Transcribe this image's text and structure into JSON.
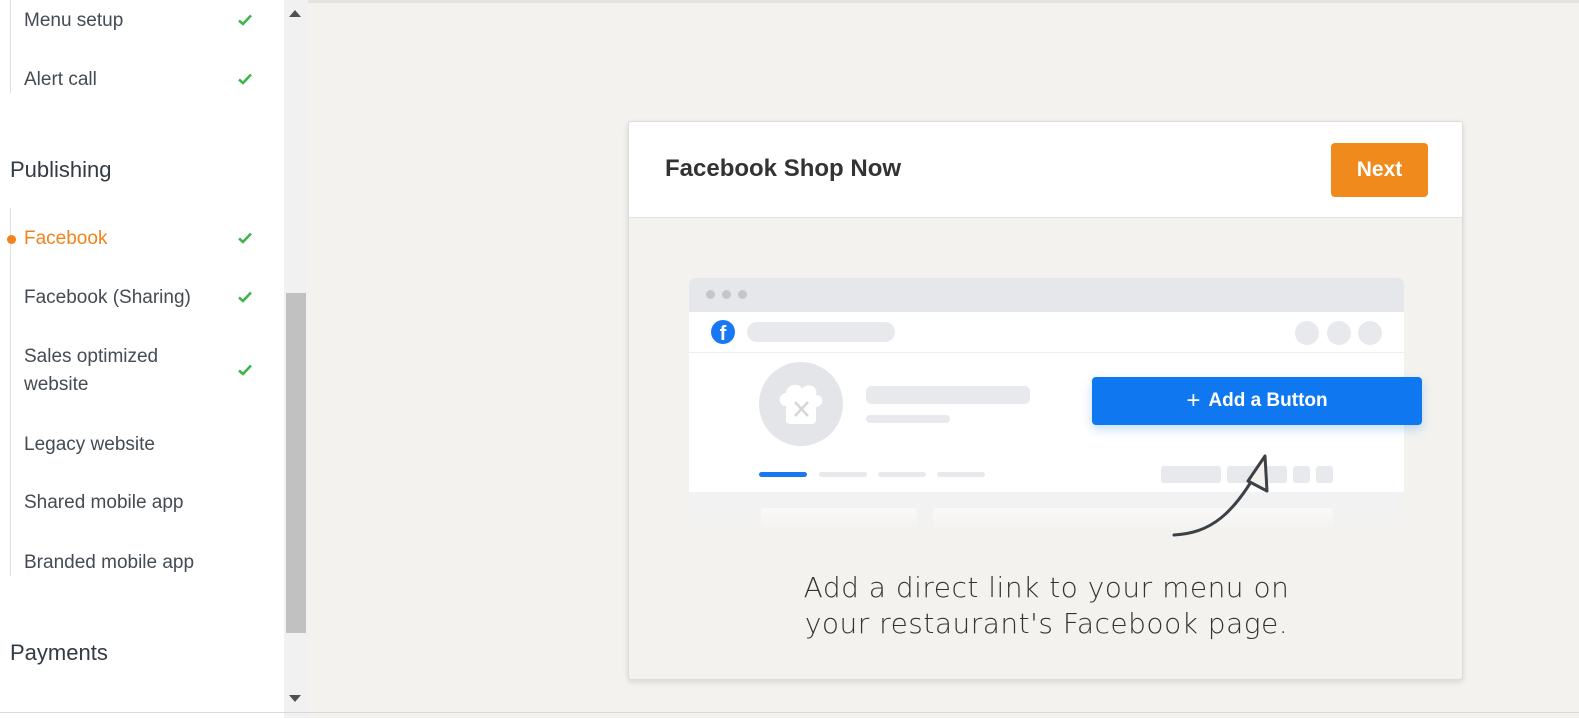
{
  "sidebar": {
    "items_top": [
      {
        "label": "Menu setup",
        "done": true
      },
      {
        "label": "Alert call",
        "done": true
      }
    ],
    "sections": {
      "publishing": "Publishing",
      "payments": "Payments"
    },
    "publishing_items": [
      {
        "label": "Facebook",
        "done": true,
        "active": true
      },
      {
        "label": "Facebook (Sharing)",
        "done": true
      },
      {
        "label": "Sales optimized website",
        "done": true
      },
      {
        "label": "Legacy website",
        "done": false
      },
      {
        "label": "Shared mobile app",
        "done": false
      },
      {
        "label": "Branded mobile app",
        "done": false
      }
    ]
  },
  "card": {
    "title": "Facebook Shop Now",
    "next_label": "Next",
    "illustration": {
      "add_button_label": "Add a Button",
      "fb_logo_icon": "facebook-logo-icon",
      "avatar_icon": "chef-hat-icon"
    },
    "tagline_line1": "Add a direct link to your menu on",
    "tagline_line2": "your restaurant's Facebook page."
  },
  "colors": {
    "accent": "#f0831e",
    "check": "#3cb64b",
    "facebook_blue": "#0f78f0"
  }
}
